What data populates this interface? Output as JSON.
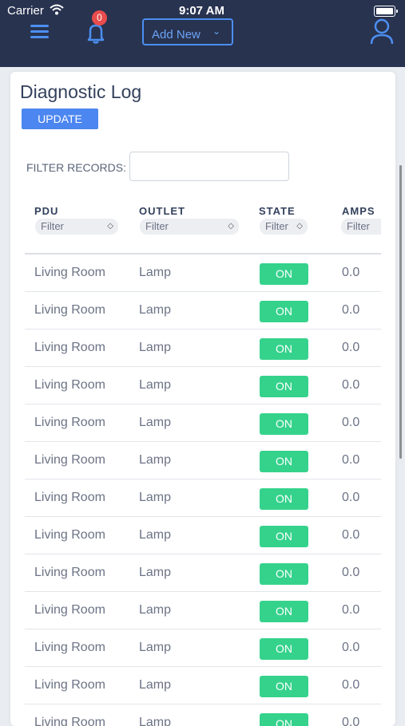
{
  "status_bar": {
    "carrier": "Carrier",
    "time": "9:07 AM"
  },
  "header": {
    "menu_icon": "hamburger-menu-icon",
    "notification_icon": "bell-icon",
    "notification_count": "0",
    "add_new_label": "Add New",
    "add_new_icon": "chevron-down-icon",
    "user_icon": "user-profile-icon",
    "colors": {
      "bar": "#283350",
      "accent": "#4c8ff0",
      "badge": "#e84c4c"
    }
  },
  "page": {
    "title": "Diagnostic Log",
    "update_label": "UPDATE",
    "filter_label": "FILTER RECORDS:",
    "filter_value": ""
  },
  "table": {
    "columns": [
      {
        "header": "PDU",
        "filter": "Filter"
      },
      {
        "header": "OUTLET",
        "filter": "Filter"
      },
      {
        "header": "STATE",
        "filter": "Filter"
      },
      {
        "header": "AMPS",
        "filter": "Filter"
      }
    ],
    "rows": [
      {
        "pdu": "Living Room",
        "outlet": "Lamp",
        "state": "ON",
        "amps": "0.0"
      },
      {
        "pdu": "Living Room",
        "outlet": "Lamp",
        "state": "ON",
        "amps": "0.0"
      },
      {
        "pdu": "Living Room",
        "outlet": "Lamp",
        "state": "ON",
        "amps": "0.0"
      },
      {
        "pdu": "Living Room",
        "outlet": "Lamp",
        "state": "ON",
        "amps": "0.0"
      },
      {
        "pdu": "Living Room",
        "outlet": "Lamp",
        "state": "ON",
        "amps": "0.0"
      },
      {
        "pdu": "Living Room",
        "outlet": "Lamp",
        "state": "ON",
        "amps": "0.0"
      },
      {
        "pdu": "Living Room",
        "outlet": "Lamp",
        "state": "ON",
        "amps": "0.0"
      },
      {
        "pdu": "Living Room",
        "outlet": "Lamp",
        "state": "ON",
        "amps": "0.0"
      },
      {
        "pdu": "Living Room",
        "outlet": "Lamp",
        "state": "ON",
        "amps": "0.0"
      },
      {
        "pdu": "Living Room",
        "outlet": "Lamp",
        "state": "ON",
        "amps": "0.0"
      },
      {
        "pdu": "Living Room",
        "outlet": "Lamp",
        "state": "ON",
        "amps": "0.0"
      },
      {
        "pdu": "Living Room",
        "outlet": "Lamp",
        "state": "ON",
        "amps": "0.0"
      },
      {
        "pdu": "Living Room",
        "outlet": "Lamp",
        "state": "ON",
        "amps": "0.0"
      }
    ],
    "state_on_color": "#35d28c"
  }
}
